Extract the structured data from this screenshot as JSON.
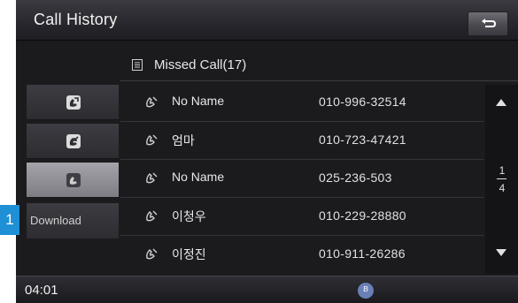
{
  "header": {
    "title": "Call History"
  },
  "subheader": {
    "label": "Missed Call(17)"
  },
  "sidebar": {
    "items": [
      {
        "name": "dialed-calls"
      },
      {
        "name": "received-calls"
      },
      {
        "name": "missed-calls",
        "active": true
      }
    ],
    "download_label": "Download"
  },
  "callout": {
    "number": "1"
  },
  "calls": [
    {
      "name": "No Name",
      "number": "010-996-32514"
    },
    {
      "name": "엄마",
      "number": "010-723-47421"
    },
    {
      "name": "No Name",
      "number": "025-236-503"
    },
    {
      "name": "이청우",
      "number": "010-229-28880"
    },
    {
      "name": "이정진",
      "number": "010-911-26286"
    }
  ],
  "scroll": {
    "page": "1",
    "total": "4"
  },
  "status": {
    "time": "04:01",
    "bluetooth_icon": "bluetooth-phone-icon"
  },
  "colors": {
    "background": "#1b1b1e",
    "callout": "#1f8fd6",
    "active_tab": "#8c8c92"
  }
}
